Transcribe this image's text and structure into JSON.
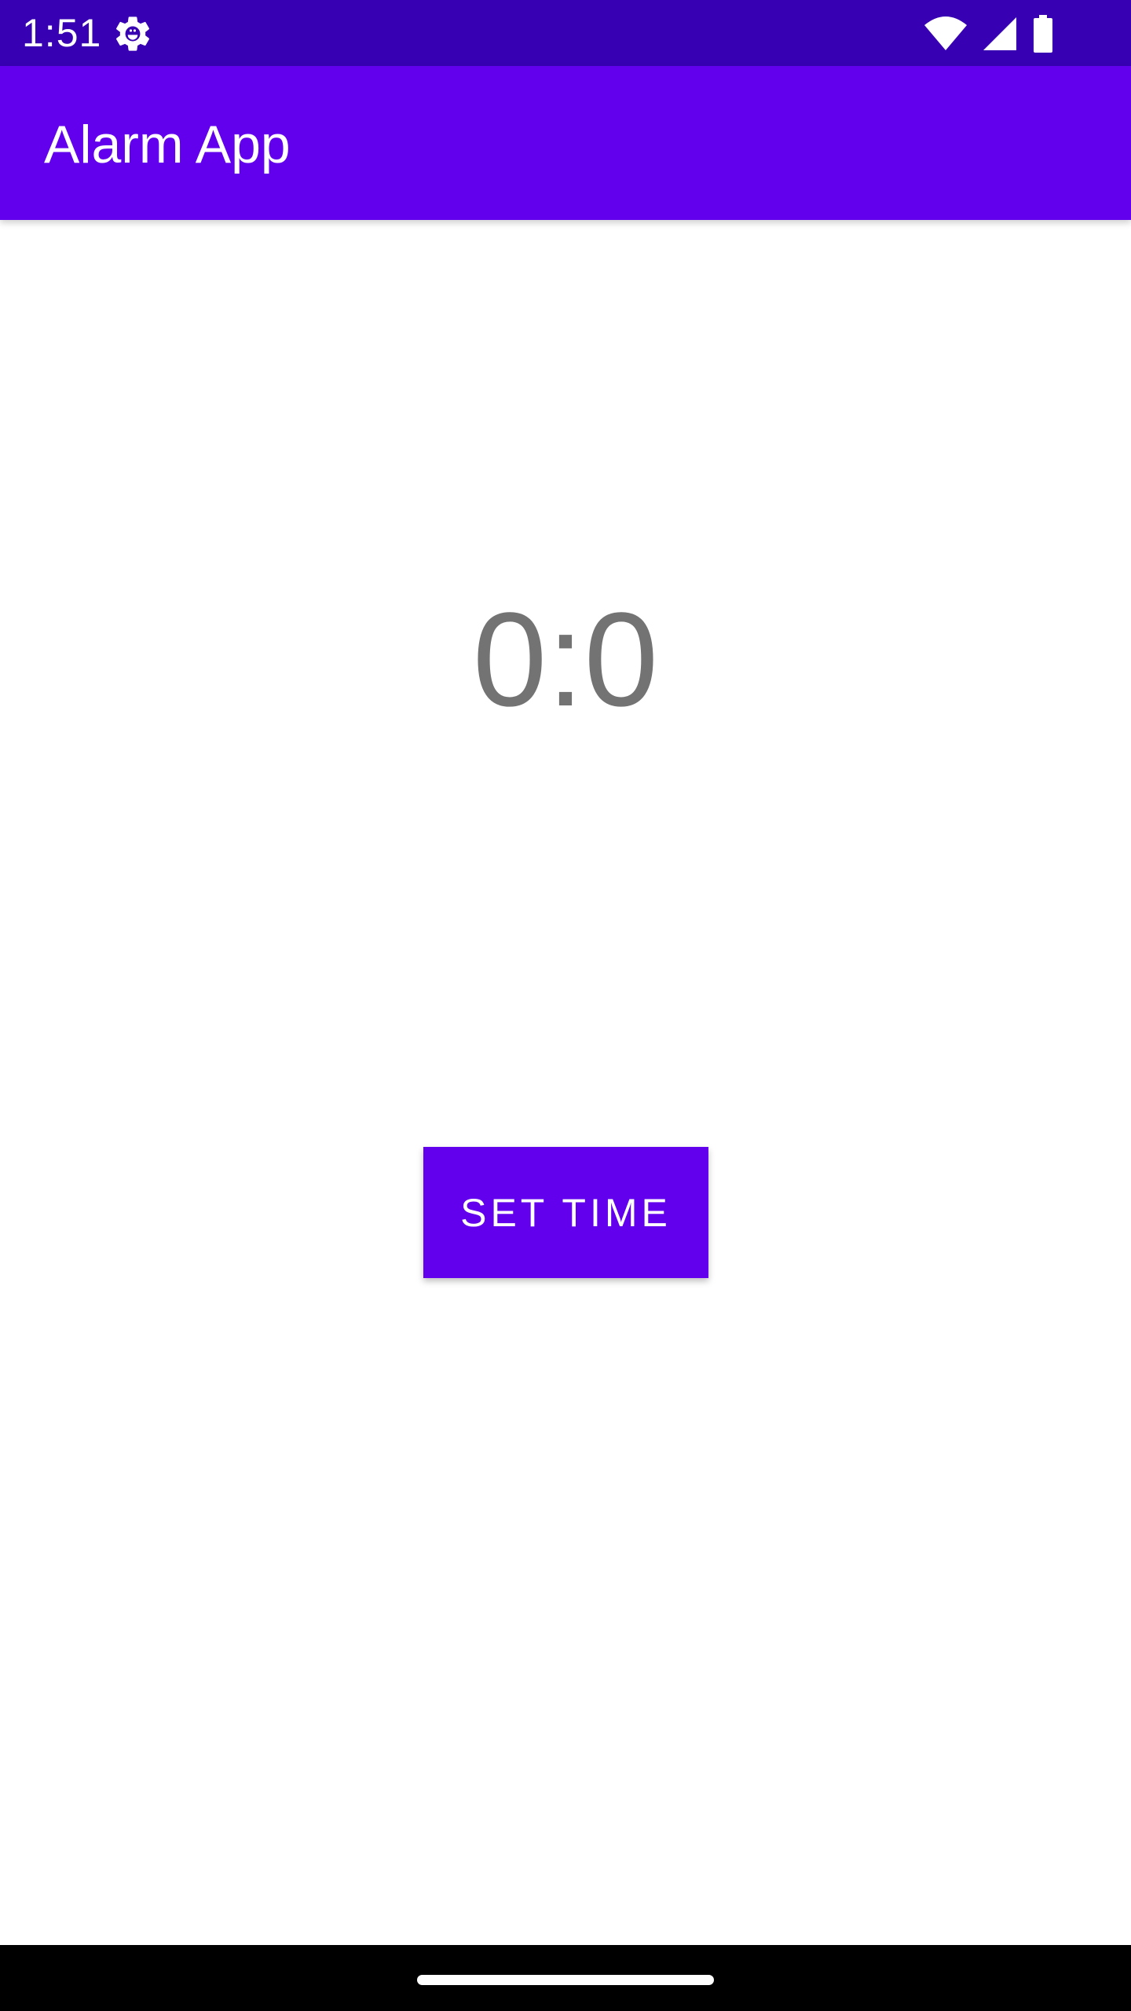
{
  "status_bar": {
    "time": "1:51",
    "icons": [
      "settings-gear-icon",
      "wifi-icon",
      "cellular-signal-icon",
      "battery-icon"
    ],
    "background_color": "#3700b3"
  },
  "app_bar": {
    "title": "Alarm App",
    "background_color": "#6200ee"
  },
  "main": {
    "time_display": "0:0",
    "set_time_button_label": "SET TIME",
    "accent_color": "#6200ee"
  },
  "nav_bar": {
    "background_color": "#000000"
  }
}
